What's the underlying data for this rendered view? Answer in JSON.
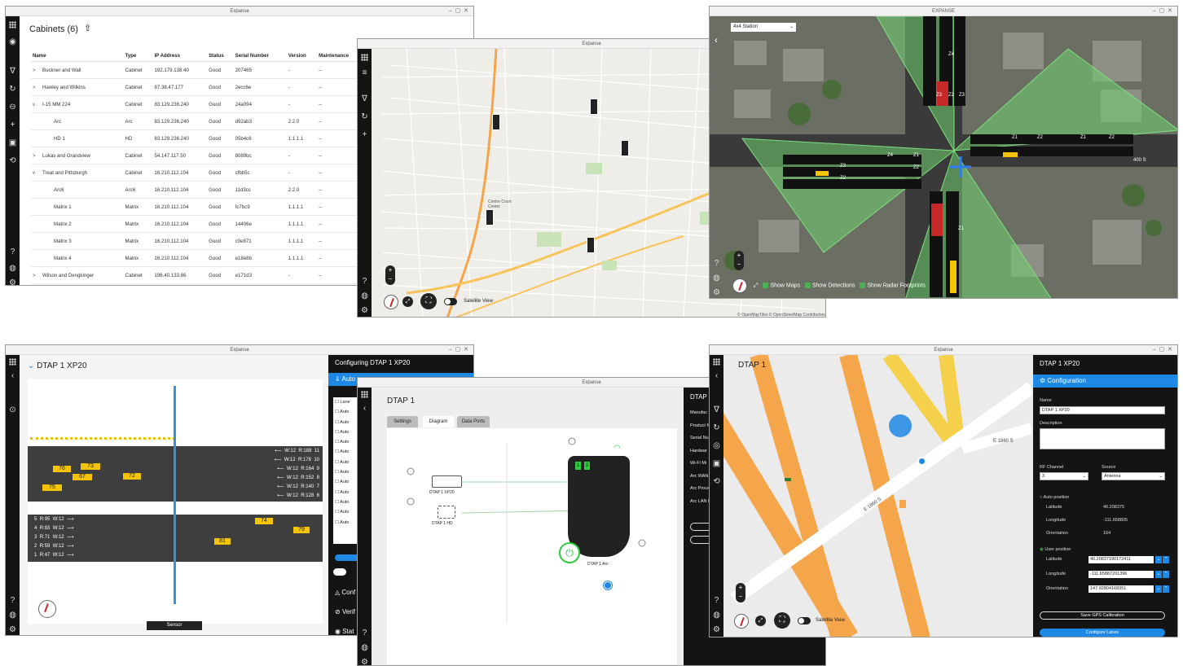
{
  "win1": {
    "title": "Expanse",
    "heading": "Cabinets (6)",
    "columns": [
      "Name",
      "Type",
      "IP Address",
      "Status",
      "Serial Number",
      "Version",
      "Maintenance"
    ],
    "rows": [
      {
        "toggle": ">",
        "name": "Buckner and Wall",
        "type": "Cabinet",
        "ip": "192.179.138.40",
        "status": "Good",
        "serial": "207465",
        "version": "-",
        "maint": "--"
      },
      {
        "toggle": ">",
        "name": "Hawley and Wilkins",
        "type": "Cabinet",
        "ip": "87.38.47.177",
        "status": "Good",
        "serial": "2ecc6e",
        "version": "-",
        "maint": "--"
      },
      {
        "toggle": "v",
        "name": "I-15 MM 224",
        "type": "Cabinet",
        "ip": "83.129.236.240",
        "status": "Good",
        "serial": "24a094",
        "version": "-",
        "maint": "--"
      },
      {
        "toggle": "",
        "name": "Arc",
        "type": "Arc",
        "ip": "83.129.236.240",
        "status": "Good",
        "serial": "d92ab3",
        "version": "2.2.0",
        "maint": "--"
      },
      {
        "toggle": "",
        "name": "HD 1",
        "type": "HD",
        "ip": "83.129.236.240",
        "status": "Good",
        "serial": "05b4c6",
        "version": "1.1.1.1",
        "maint": "--"
      },
      {
        "toggle": ">",
        "name": "Lukas and Grandview",
        "type": "Cabinet",
        "ip": "54.147.117.50",
        "status": "Good",
        "serial": "8089bc",
        "version": "-",
        "maint": "--"
      },
      {
        "toggle": "v",
        "name": "Treat and Pittsburgh",
        "type": "Cabinet",
        "ip": "16.210.112.104",
        "status": "Good",
        "serial": "cfbb5c",
        "version": "-",
        "maint": "--"
      },
      {
        "toggle": "",
        "name": "Arc6",
        "type": "Arc6",
        "ip": "16.210.112.104",
        "status": "Good",
        "serial": "11d3cc",
        "version": "2.2.0",
        "maint": "--"
      },
      {
        "toggle": "",
        "name": "Matrix 1",
        "type": "Matrix",
        "ip": "16.210.112.104",
        "status": "Good",
        "serial": "fc7bc9",
        "version": "1.1.1.1",
        "maint": "--"
      },
      {
        "toggle": "",
        "name": "Matrix 2",
        "type": "Matrix",
        "ip": "16.210.112.104",
        "status": "Good",
        "serial": "14406e",
        "version": "1.1.1.1",
        "maint": "--"
      },
      {
        "toggle": "",
        "name": "Matrix 3",
        "type": "Matrix",
        "ip": "16.210.112.104",
        "status": "Good",
        "serial": "c0e871",
        "version": "1.1.1.1",
        "maint": "--"
      },
      {
        "toggle": "",
        "name": "Matrix 4",
        "type": "Matrix",
        "ip": "16.210.112.104",
        "status": "Good",
        "serial": "e18e8b",
        "version": "1.1.1.1",
        "maint": "--"
      },
      {
        "toggle": ">",
        "name": "Wilson and Dengkinger",
        "type": "Cabinet",
        "ip": "196.40.133.86",
        "status": "Good",
        "serial": "e171d3",
        "version": "-",
        "maint": "--"
      }
    ]
  },
  "win2": {
    "title": "Expanse",
    "satellite_label": "Satellite View",
    "map_label": "Centre Court\nCenter"
  },
  "win3": {
    "title": "EXPANSE",
    "dropdown": "4x4 Station",
    "toggles": [
      "Show Maps",
      "Show Detections",
      "Show Radar Footprints"
    ],
    "street_label": "400 S",
    "attribution": "© OpenMapTiles © OpenStreetMap Contributors",
    "zones": [
      "Z4",
      "Z3",
      "Z2",
      "Z3",
      "Z1",
      "Z2",
      "Z1",
      "Z2",
      "Z1",
      "Z2",
      "Z4",
      "Z3",
      "Z2",
      "Z1"
    ]
  },
  "win4": {
    "title": "Expanse",
    "heading": "DTAP 1 XP20",
    "sensor_label": "Sensor",
    "right_lanes": [
      {
        "w": "W:12",
        "r": "R:188",
        "n": "11"
      },
      {
        "w": "W:12",
        "r": "R:176",
        "n": "10"
      },
      {
        "w": "W:12",
        "r": "R:164",
        "n": "9"
      },
      {
        "w": "W:12",
        "r": "R:152",
        "n": "8"
      },
      {
        "w": "W:12",
        "r": "R:140",
        "n": "7"
      },
      {
        "w": "W:12",
        "r": "R:128",
        "n": "6"
      }
    ],
    "left_lanes": [
      {
        "n": "5",
        "r": "R:95",
        "w": "W:12"
      },
      {
        "n": "4",
        "r": "R:83",
        "w": "W:12"
      },
      {
        "n": "3",
        "r": "R:71",
        "w": "W:12"
      },
      {
        "n": "2",
        "r": "R:59",
        "w": "W:12"
      },
      {
        "n": "1",
        "r": "R:47",
        "w": "W:12"
      }
    ],
    "vehicles": [
      "76",
      "73",
      "67",
      "72",
      "75",
      "74",
      "79",
      "81"
    ],
    "config_title": "Configuring DTAP 1 XP20",
    "config_tab": "Auto",
    "config_items": [
      "Lane",
      "Auto",
      "Auto",
      "Auto",
      "Auto",
      "Auto",
      "Auto",
      "Auto",
      "Auto",
      "Auto",
      "Auto",
      "Auto",
      "Auto"
    ],
    "sections": [
      "Conf",
      "Verif",
      "Stat"
    ]
  },
  "win5": {
    "title": "Expanse",
    "heading": "DTAP 1",
    "tabs": [
      "Settings",
      "Diagram",
      "Data Ports"
    ],
    "nodes": [
      "DTAP 1 XP20",
      "DTAP 1 HD",
      "DTAP 1 Arc"
    ],
    "device_ports": [
      "1",
      "2"
    ],
    "side_title": "DTAP",
    "side_items": [
      "Manufac",
      "Product N",
      "Serial Nu",
      "Hardwar",
      "Wi-Fi Mi",
      "Arc WAN",
      "Arc Proce",
      "Arc LAN I"
    ]
  },
  "win6": {
    "title": "Expanse",
    "heading": "DTAP 1",
    "satellite_label": "Satellite View",
    "road_labels": [
      "E 1860 S",
      "E 1860 S"
    ],
    "panel": {
      "title": "DTAP 1 XP20",
      "section": "Configuration",
      "name_label": "Name",
      "name_value": "DTAP 1 XP20",
      "desc_label": "Description",
      "rf_label": "RF Channel",
      "rf_value": "3",
      "source_label": "Source",
      "source_value": "Antenna",
      "auto_label": "Auto position",
      "auto": [
        [
          "Latitude",
          "40.208375"
        ],
        [
          "Longitude",
          "-111.658805"
        ],
        [
          "Orientation",
          "164"
        ]
      ],
      "user_label": "User position",
      "user": [
        [
          "Latitude",
          "40.20837190172411"
        ],
        [
          "Longitude",
          "-111.65887201396"
        ],
        [
          "Orientation",
          "147.92804168351"
        ]
      ],
      "save_btn": "Save GPS Calibration",
      "lanes_btn": "Configure Lanes"
    }
  },
  "colors": {
    "accent": "#1e88e5",
    "rail": "#141414",
    "good_green": "#4caf50",
    "vehicle_yellow": "#f5c400",
    "road_orange": "#f5a54a"
  }
}
